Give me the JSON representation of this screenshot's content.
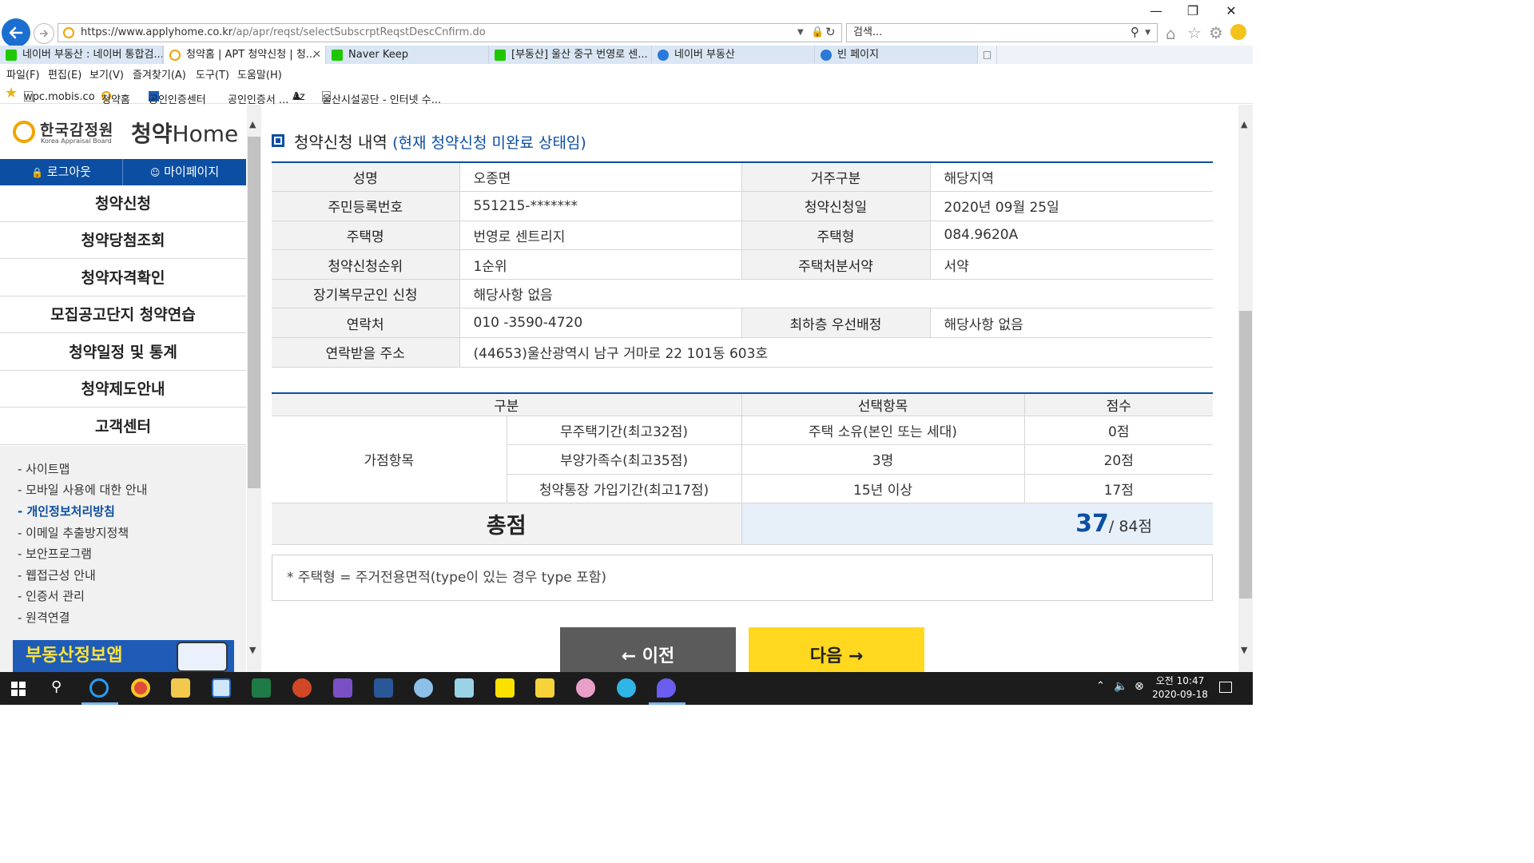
{
  "browser": {
    "url_host": "https://www.applyhome.co.kr",
    "url_path": "/ap/apr/reqst/selectSubscrptReqstDescCnfirm.do",
    "search_placeholder": "검색...",
    "tabs": [
      {
        "label": "네이버 부동산 : 네이버 통합검...",
        "color": "#1ec800"
      },
      {
        "label": "청약홈 | APT 청약신청 | 청...",
        "color": "#f0a500"
      },
      {
        "label": "Naver Keep",
        "color": "#1ec800"
      },
      {
        "label": "[부동산] 울산 중구 번영로 센...",
        "color": "#1ec800"
      },
      {
        "label": "네이버 부동산",
        "color": "#2b79d8"
      },
      {
        "label": "빈 페이지",
        "color": "#2b79d8"
      }
    ],
    "menu": [
      "파일(F)",
      "편집(E)",
      "보기(V)",
      "즐겨찾기(A)",
      "도구(T)",
      "도움말(H)"
    ],
    "favorites": [
      "wpc.mobis.co",
      "청약홈",
      "공인인증센터",
      "공인인증서 ...",
      "Az",
      "울산시설공단 - 인터넷 수..."
    ]
  },
  "sidebar": {
    "logo_kr": "한국감정원",
    "logo_en": "Korea Appraisal Board",
    "logo_service": "청약",
    "logo_home": "Home",
    "logout": "로그아웃",
    "mypage": "마이페이지",
    "menu": [
      "청약신청",
      "청약당첨조회",
      "청약자격확인",
      "모집공고단지 청약연습",
      "청약일정 및 통계",
      "청약제도안내",
      "고객센터"
    ],
    "sub": [
      "- 사이트맵",
      "- 모바일 사용에 대한 안내",
      "- 개인정보처리방침",
      "- 이메일 추출방지정책",
      "- 보안프로그램",
      "- 웹접근성 안내",
      "- 인증서 관리",
      "- 원격연결"
    ],
    "promo": "부동산정보앱"
  },
  "main": {
    "title": "청약신청 내역",
    "title_note": "(현재 청약신청 미완료 상태임)",
    "info": {
      "name_lbl": "성명",
      "name": "오종면",
      "residence_lbl": "거주구분",
      "residence": "해당지역",
      "rrn_lbl": "주민등록번호",
      "rrn": "551215-*******",
      "date_lbl": "청약신청일",
      "date": "2020년 09월 25일",
      "house_lbl": "주택명",
      "house": "번영로 센트리지",
      "type_lbl": "주택형",
      "type": "084.9620A",
      "rank_lbl": "청약신청순위",
      "rank": "1순위",
      "pledge_lbl": "주택처분서약",
      "pledge": "서약",
      "military_lbl": "장기복무군인 신청",
      "military": "해당사항 없음",
      "contact_lbl": "연락처",
      "contact": "010 -3590-4720",
      "lowfloor_lbl": "최하층 우선배정",
      "lowfloor": "해당사항 없음",
      "address_lbl": "연락받을 주소",
      "address": "(44653)울산광역시 남구 거마로 22 101동 603호"
    },
    "score": {
      "head_category": "구분",
      "head_choice": "선택항목",
      "head_points": "점수",
      "group": "가점항목",
      "rows": [
        {
          "item": "무주택기간(최고32점)",
          "choice": "주택 소유(본인 또는 세대)",
          "points": "0점"
        },
        {
          "item": "부양가족수(최고35점)",
          "choice": "3명",
          "points": "20점"
        },
        {
          "item": "청약통장 가입기간(최고17점)",
          "choice": "15년 이상",
          "points": "17점"
        }
      ],
      "total_lbl": "총점",
      "total": "37",
      "total_max": "/ 84점"
    },
    "footnote": "* 주택형 = 주거전용면적(type이 있는 경우 type 포함)",
    "prev": "← 이전",
    "next": "다음 →"
  },
  "taskbar": {
    "time": "오전 10:47",
    "date": "2020-09-18"
  }
}
